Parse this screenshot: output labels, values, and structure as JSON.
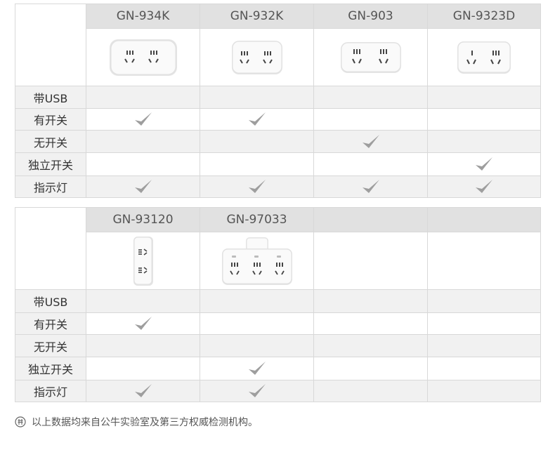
{
  "colors": {
    "border": "#d8d8d8",
    "header_bg": "#e1e1e1",
    "row_bg": "#f1f1f1",
    "check": "#9e9e9e"
  },
  "tables": [
    {
      "models": [
        "GN-934K",
        "GN-932K",
        "GN-903",
        "GN-9323D"
      ],
      "features": [
        {
          "label": "带USB",
          "checks": [
            false,
            false,
            false,
            false
          ]
        },
        {
          "label": "有开关",
          "checks": [
            true,
            true,
            false,
            false
          ]
        },
        {
          "label": "无开关",
          "checks": [
            false,
            false,
            true,
            false
          ]
        },
        {
          "label": "独立开关",
          "checks": [
            false,
            false,
            false,
            true
          ]
        },
        {
          "label": "指示灯",
          "checks": [
            true,
            true,
            true,
            true
          ]
        }
      ]
    },
    {
      "models": [
        "GN-93120",
        "GN-97033",
        "",
        ""
      ],
      "features": [
        {
          "label": "带USB",
          "checks": [
            false,
            false,
            false,
            false
          ]
        },
        {
          "label": "有开关",
          "checks": [
            true,
            false,
            false,
            false
          ]
        },
        {
          "label": "无开关",
          "checks": [
            false,
            false,
            false,
            false
          ]
        },
        {
          "label": "独立开关",
          "checks": [
            false,
            true,
            false,
            false
          ]
        },
        {
          "label": "指示灯",
          "checks": [
            true,
            true,
            false,
            false
          ]
        }
      ]
    }
  ],
  "footnote": {
    "icon": "info-circle-icon",
    "text": "以上数据均来自公牛实验室及第三方权威检测机构。"
  }
}
